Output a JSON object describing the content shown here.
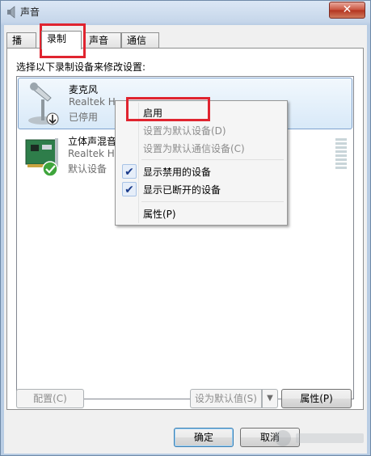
{
  "window": {
    "title": "声音",
    "close_label": "✕"
  },
  "tabs": [
    {
      "label": "播放"
    },
    {
      "label": "录制"
    },
    {
      "label": "声音"
    },
    {
      "label": "通信"
    }
  ],
  "panel": {
    "instruction": "选择以下录制设备来修改设置:"
  },
  "devices": [
    {
      "name": "麦克风",
      "driver": "Realtek H",
      "status": "已停用",
      "icon": "microphone-icon"
    },
    {
      "name": "立体声混音",
      "driver": "Realtek H",
      "status": "默认设备",
      "icon": "sound-card-icon"
    }
  ],
  "context_menu": {
    "items": [
      {
        "label": "启用",
        "enabled": true,
        "checked": false
      },
      {
        "label": "设置为默认设备(D)",
        "enabled": false,
        "checked": false
      },
      {
        "label": "设置为默认通信设备(C)",
        "enabled": false,
        "checked": false
      },
      {
        "label": "显示禁用的设备",
        "enabled": true,
        "checked": true
      },
      {
        "label": "显示已断开的设备",
        "enabled": true,
        "checked": true
      },
      {
        "label": "属性(P)",
        "enabled": true,
        "checked": false
      }
    ],
    "check_glyph": "✔"
  },
  "buttons": {
    "configure": "配置(C)",
    "set_default": "设为默认值(S)",
    "set_default_arrow": "▼",
    "properties": "属性(P)",
    "ok": "确定",
    "cancel": "取消"
  },
  "colors": {
    "highlight": "#e0242f",
    "selection": "#d8e9f8"
  }
}
